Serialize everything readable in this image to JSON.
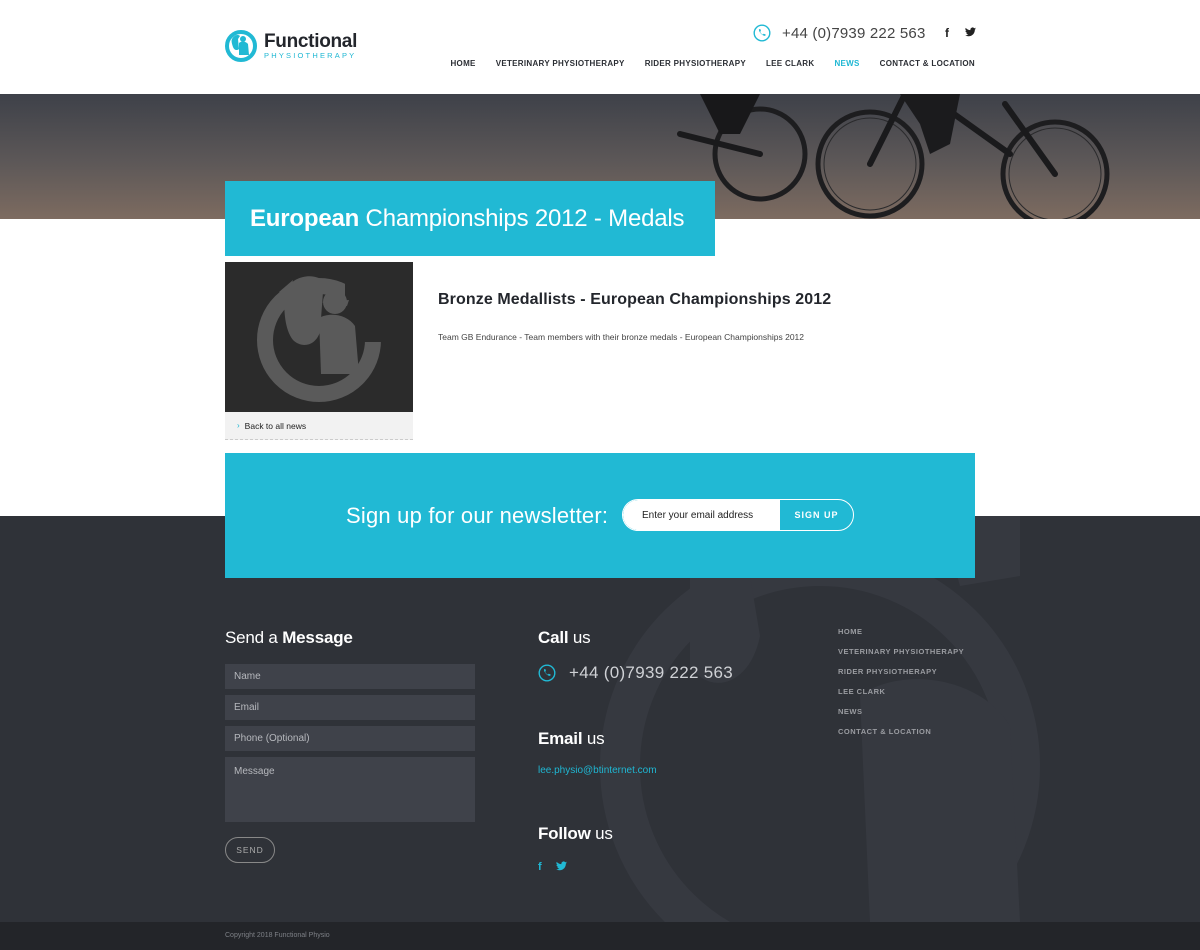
{
  "brand": {
    "name": "Functional",
    "tagline": "PHYSIOTHERAPY",
    "accent": "#21b9d4"
  },
  "header": {
    "phone": "+44 (0)7939 222 563",
    "social": [
      {
        "icon": "facebook-icon",
        "glyph": "f"
      },
      {
        "icon": "twitter-icon",
        "glyph": "🐦"
      }
    ],
    "nav": [
      {
        "label": "HOME",
        "active": false
      },
      {
        "label": "VETERINARY PHYSIOTHERAPY",
        "active": false
      },
      {
        "label": "RIDER PHYSIOTHERAPY",
        "active": false
      },
      {
        "label": "LEE CLARK",
        "active": false
      },
      {
        "label": "NEWS",
        "active": true
      },
      {
        "label": "CONTACT & LOCATION",
        "active": false
      }
    ]
  },
  "page": {
    "title_bold": "European",
    "title_rest": " Championships 2012 - Medals"
  },
  "article": {
    "title": "Bronze Medallists - European Championships 2012",
    "body": "Team GB Endurance - Team members with their bronze medals - European Championships 2012",
    "back_label": "Back to all news"
  },
  "newsletter": {
    "label": "Sign up for our newsletter:",
    "placeholder": "Enter your email address",
    "button": "SIGN UP"
  },
  "footer": {
    "message_heading_light": "Send a ",
    "message_heading_bold": "Message",
    "fields": {
      "name": "Name",
      "email": "Email",
      "phone": "Phone (Optional)",
      "message": "Message"
    },
    "send": "SEND",
    "call_bold": "Call",
    "call_light": " us",
    "phone": "+44 (0)7939 222 563",
    "email_bold": "Email",
    "email_light": " us",
    "email": "lee.physio@btinternet.com",
    "follow_bold": "Follow",
    "follow_light": " us",
    "follow_icons": [
      {
        "icon": "facebook-icon",
        "glyph": "f"
      },
      {
        "icon": "twitter-icon",
        "glyph": "🐦"
      }
    ],
    "nav": [
      "HOME",
      "VETERINARY PHYSIOTHERAPY",
      "RIDER PHYSIOTHERAPY",
      "LEE CLARK",
      "NEWS",
      "CONTACT & LOCATION"
    ],
    "copyright": "Copyright 2018 Functional Physio"
  }
}
